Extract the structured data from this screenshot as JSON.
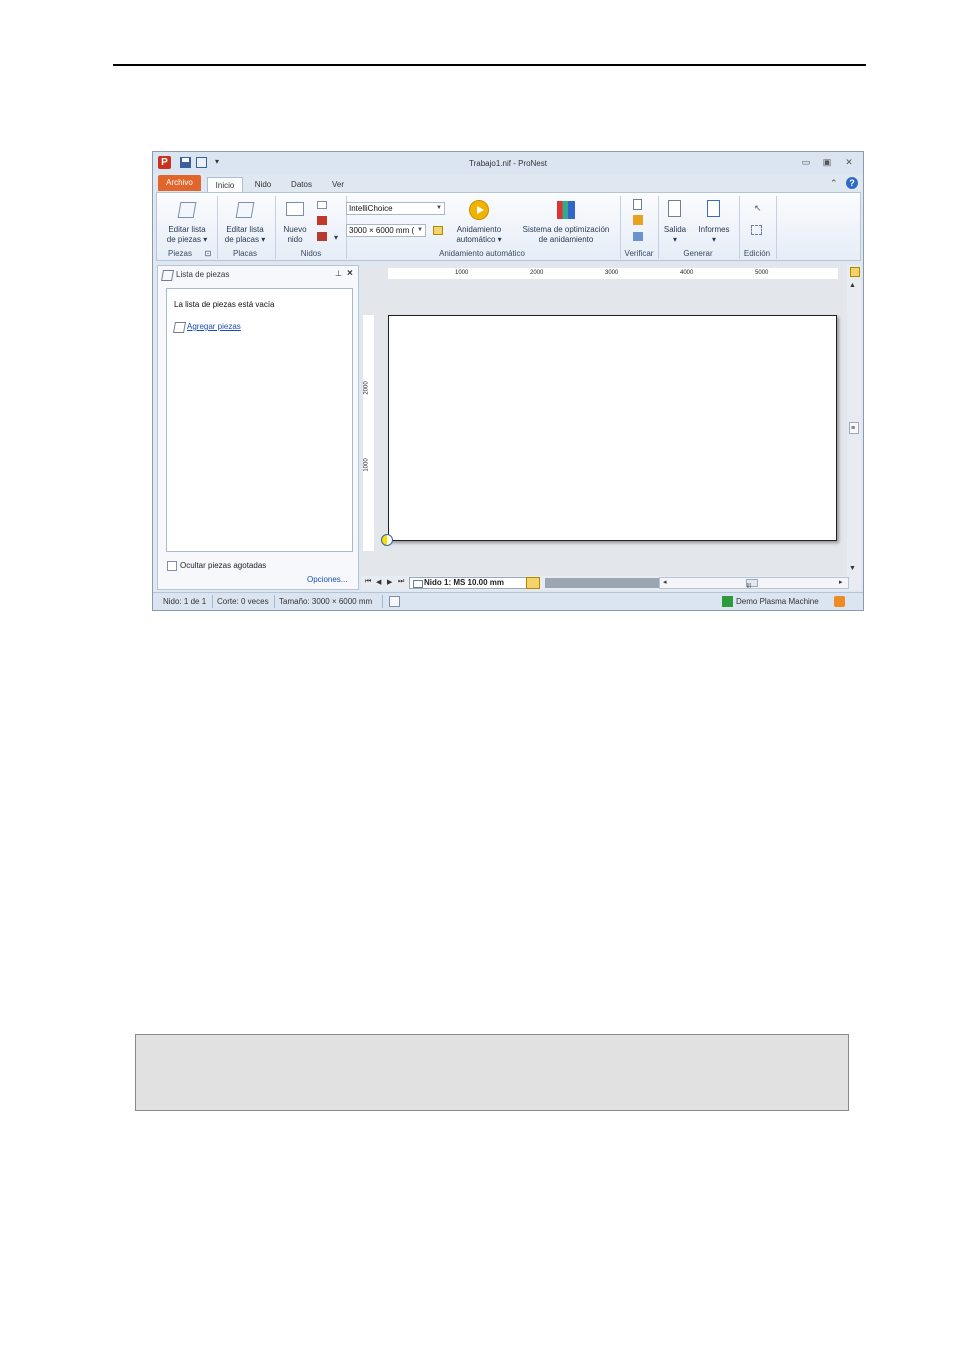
{
  "window": {
    "title": "Trabajo1.nif - ProNest",
    "app_logo": "P",
    "qat_dropdown": "▾",
    "minimize": "▭",
    "maximize": "▣",
    "close": "✕"
  },
  "tabs": [
    {
      "label": "Archivo"
    },
    {
      "label": "Inicio",
      "active": true
    },
    {
      "label": "Nido"
    },
    {
      "label": "Datos"
    },
    {
      "label": "Ver"
    }
  ],
  "help": {
    "caret": "⌃",
    "icon": "?"
  },
  "ribbon": {
    "piezas": {
      "btn_line1": "Editar lista",
      "btn_line2": "de piezas ▾",
      "group": "Piezas",
      "launcher": "⊡"
    },
    "placas": {
      "btn_line1": "Editar lista",
      "btn_line2": "de placas ▾",
      "group": "Placas"
    },
    "nidos": {
      "btn_line1": "Nuevo",
      "btn_line2": "nido",
      "dropdown": "▾",
      "group": "Nidos"
    },
    "auto": {
      "strategy": "IntelliChoice",
      "plate_size": "3000 × 6000 mm (",
      "btn_line1": "Anidamiento",
      "btn_line2": "automático ▾",
      "opt_line1": "Sistema de optimización",
      "opt_line2": "de anidamiento",
      "group": "Anidamiento automático"
    },
    "verificar": {
      "group": "Verificar"
    },
    "generar": {
      "salida": "Salida",
      "salida_arrow": "▾",
      "informes": "Informes",
      "informes_arrow": "▾",
      "group": "Generar"
    },
    "edicion": {
      "group": "Edición"
    }
  },
  "panel": {
    "title": "Lista de piezas",
    "pin": "⊥",
    "close": "×",
    "empty_message": "La lista de piezas está vacía",
    "add_link": "Agregar piezas",
    "hide_label": "Ocultar piezas agotadas",
    "options_link": "Opciones..."
  },
  "rulers": {
    "h_ticks": [
      "1000",
      "2000",
      "3000",
      "4000",
      "5000"
    ],
    "v_ticks": [
      "2000",
      "1000"
    ]
  },
  "sheetbar": {
    "nav": [
      "⏮",
      "◀",
      "▶",
      "⏭"
    ],
    "tab_label": "Nido 1: MS 10.00 mm",
    "h_left": "◂",
    "h_thumb": "|||",
    "h_right": "▸"
  },
  "vscroll": {
    "up": "▲",
    "thumb": "≡",
    "down": "▼"
  },
  "status": {
    "nest": "Nido: 1 de 1",
    "cut": "Corte: 0 veces",
    "size": "Tamaño: 3000 × 6000 mm",
    "machine": "Demo Plasma Machine"
  },
  "colors": {
    "file_tab": "#e2662c",
    "link": "#1a4fb3",
    "play": "#f0b400"
  }
}
